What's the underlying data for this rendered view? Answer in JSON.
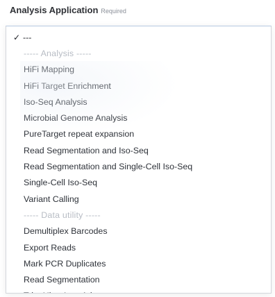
{
  "field": {
    "label": "Analysis Application",
    "required": "Required"
  },
  "dropdown": {
    "selected_marker": "✓",
    "options": [
      {
        "label": "---",
        "kind": "option",
        "selected": true
      },
      {
        "label": "----- Analysis -----",
        "kind": "group"
      },
      {
        "label": "HiFi Mapping",
        "kind": "option"
      },
      {
        "label": "HiFi Target Enrichment",
        "kind": "option"
      },
      {
        "label": "Iso-Seq Analysis",
        "kind": "option"
      },
      {
        "label": "Microbial Genome Analysis",
        "kind": "option"
      },
      {
        "label": "PureTarget repeat expansion",
        "kind": "option"
      },
      {
        "label": "Read Segmentation and Iso-Seq",
        "kind": "option"
      },
      {
        "label": "Read Segmentation and Single-Cell Iso-Seq",
        "kind": "option"
      },
      {
        "label": "Single-Cell Iso-Seq",
        "kind": "option"
      },
      {
        "label": "Variant Calling",
        "kind": "option"
      },
      {
        "label": "----- Data utility -----",
        "kind": "group"
      },
      {
        "label": "Demultiplex Barcodes",
        "kind": "option"
      },
      {
        "label": "Export Reads",
        "kind": "option"
      },
      {
        "label": "Mark PCR Duplicates",
        "kind": "option"
      },
      {
        "label": "Read Segmentation",
        "kind": "option"
      },
      {
        "label": "Trim Ultra-Low Adapters",
        "kind": "option"
      }
    ]
  },
  "colors": {
    "text": "#2e3239",
    "group_text": "#b7bcc4",
    "border": "#d3d6db",
    "focus_border": "#b6c9e2"
  }
}
